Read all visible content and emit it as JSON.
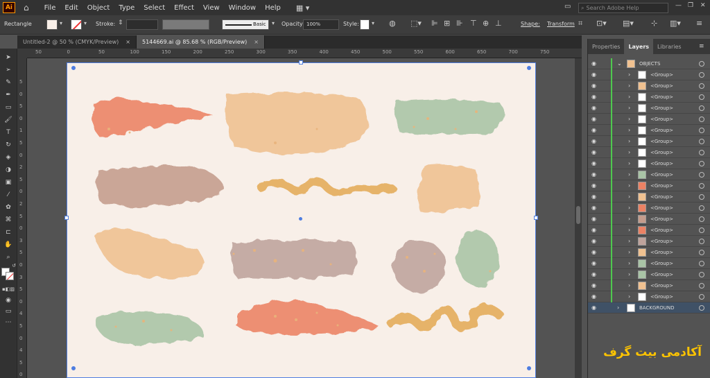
{
  "app": {
    "logo": "Ai"
  },
  "menu": [
    "File",
    "Edit",
    "Object",
    "Type",
    "Select",
    "Effect",
    "View",
    "Window",
    "Help"
  ],
  "search": {
    "placeholder": "Search Adobe Help"
  },
  "control": {
    "tool_name": "Rectangle",
    "stroke_label": "Stroke:",
    "brush_label": "Basic",
    "opacity_label": "Opacity:",
    "opacity_value": "100%",
    "style_label": "Style:",
    "shape_label": "Shape:",
    "transform_label": "Transform"
  },
  "tabs": [
    {
      "label": "Untitled-2 @ 50 % (CMYK/Preview)",
      "close": "×"
    },
    {
      "label": "5144669.ai @ 85.68 % (RGB/Preview)",
      "close": "×"
    }
  ],
  "ruler_h": [
    "50",
    "0",
    "50",
    "100",
    "150",
    "200",
    "250",
    "300",
    "350",
    "400",
    "450",
    "500",
    "550",
    "600",
    "650",
    "700",
    "750"
  ],
  "ruler_v": [
    "5",
    "0",
    "5",
    "0",
    "1",
    "5",
    "0",
    "2",
    "5",
    "0",
    "2",
    "5",
    "0",
    "3",
    "5",
    "0",
    "3",
    "5",
    "0",
    "4",
    "5",
    "0",
    "4",
    "5",
    "0"
  ],
  "panel": {
    "tabs": [
      "Properties",
      "Layers",
      "Libraries"
    ],
    "layers": [
      {
        "name": "OBJECTS",
        "level": 0
      },
      {
        "name": "<Group>",
        "level": 1
      },
      {
        "name": "<Group>",
        "level": 1
      },
      {
        "name": "<Group>",
        "level": 1
      },
      {
        "name": "<Group>",
        "level": 1
      },
      {
        "name": "<Group>",
        "level": 1
      },
      {
        "name": "<Group>",
        "level": 1
      },
      {
        "name": "<Group>",
        "level": 1
      },
      {
        "name": "<Group>",
        "level": 1
      },
      {
        "name": "<Group>",
        "level": 1
      },
      {
        "name": "<Group>",
        "level": 1
      },
      {
        "name": "<Group>",
        "level": 1
      },
      {
        "name": "<Group>",
        "level": 1
      },
      {
        "name": "<Group>",
        "level": 1
      },
      {
        "name": "<Group>",
        "level": 1
      },
      {
        "name": "<Group>",
        "level": 1
      },
      {
        "name": "<Group>",
        "level": 1
      },
      {
        "name": "<Group>",
        "level": 1
      },
      {
        "name": "<Group>",
        "level": 1
      },
      {
        "name": "<Group>",
        "level": 1
      },
      {
        "name": "<Group>",
        "level": 1
      },
      {
        "name": "<Group>",
        "level": 1
      },
      {
        "name": "BACKGROUND",
        "level": 0
      }
    ]
  },
  "watermark": "آکادمی بیت گرف",
  "colors": {
    "coral": "#ec8264",
    "peach": "#f0c190",
    "sage": "#a9c4a6",
    "mauve": "#c49c8c",
    "mustard": "#e4ab58",
    "taupe": "#bfa39c",
    "selection": "#4e7de0",
    "layer_bar": "#4ec94e"
  }
}
